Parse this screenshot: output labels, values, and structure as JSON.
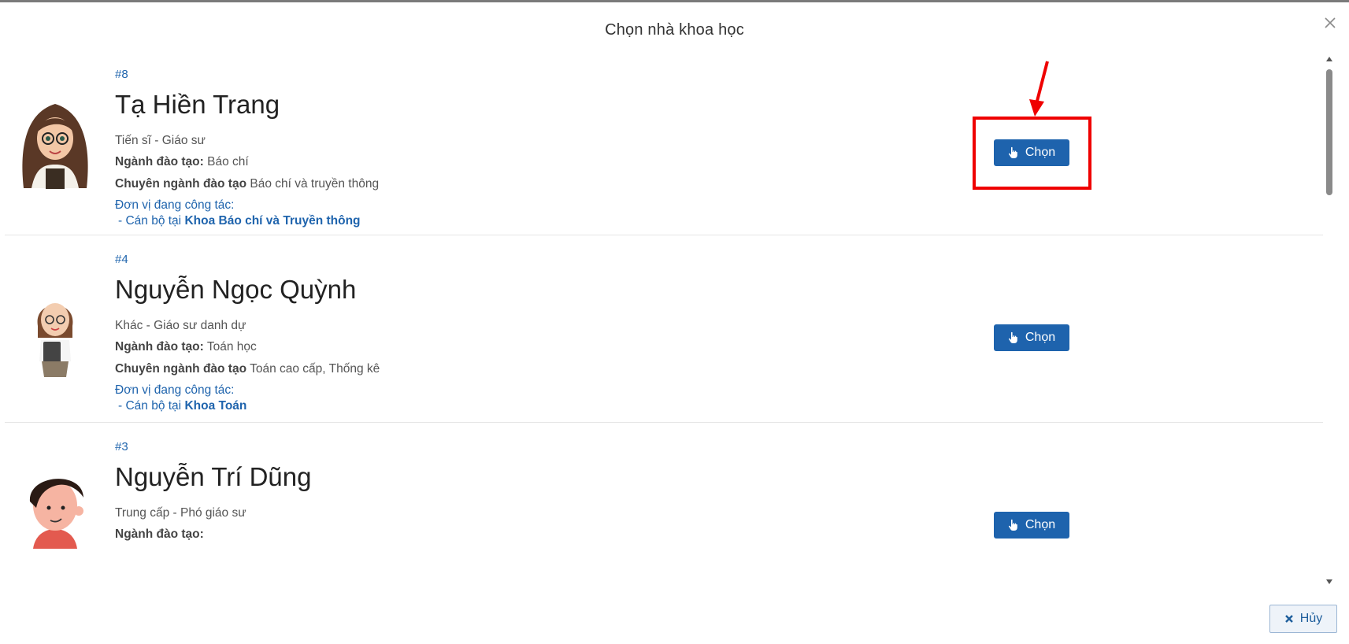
{
  "modal": {
    "title": "Chọn nhà khoa học"
  },
  "scientists": [
    {
      "id": "#8",
      "name": "Tạ Hiền Trang",
      "rank": "Tiến sĩ - Giáo sư",
      "field_label": "Ngành đào tạo:",
      "field": "Báo chí",
      "specialty_label": "Chuyên ngành đào tạo",
      "specialty": "Báo chí và truyền thông",
      "org_label": "Đơn vị đang công tác:",
      "org_prefix": "- Cán bộ tại",
      "org_name": "Khoa Báo chí và Truyền thông",
      "select_label": "Chọn"
    },
    {
      "id": "#4",
      "name": "Nguyễn Ngọc Quỳnh",
      "rank": "Khác - Giáo sư danh dự",
      "field_label": "Ngành đào tạo:",
      "field": "Toán học",
      "specialty_label": "Chuyên ngành đào tạo",
      "specialty": "Toán cao cấp, Thống kê",
      "org_label": "Đơn vị đang công tác:",
      "org_prefix": "- Cán bộ tại",
      "org_name": "Khoa Toán",
      "select_label": "Chọn"
    },
    {
      "id": "#3",
      "name": "Nguyễn Trí Dũng",
      "rank": "Trung cấp - Phó giáo sư",
      "field_label": "Ngành đào tạo:",
      "field": "",
      "select_label": "Chọn"
    }
  ],
  "footer": {
    "cancel_label": "Hủy"
  },
  "icons": {
    "close": "close-icon",
    "select": "pointer-hand-icon",
    "cancel": "x-icon"
  },
  "colors": {
    "primary": "#1e63ad",
    "link": "#1f64ad",
    "highlight": "#ef0000"
  }
}
